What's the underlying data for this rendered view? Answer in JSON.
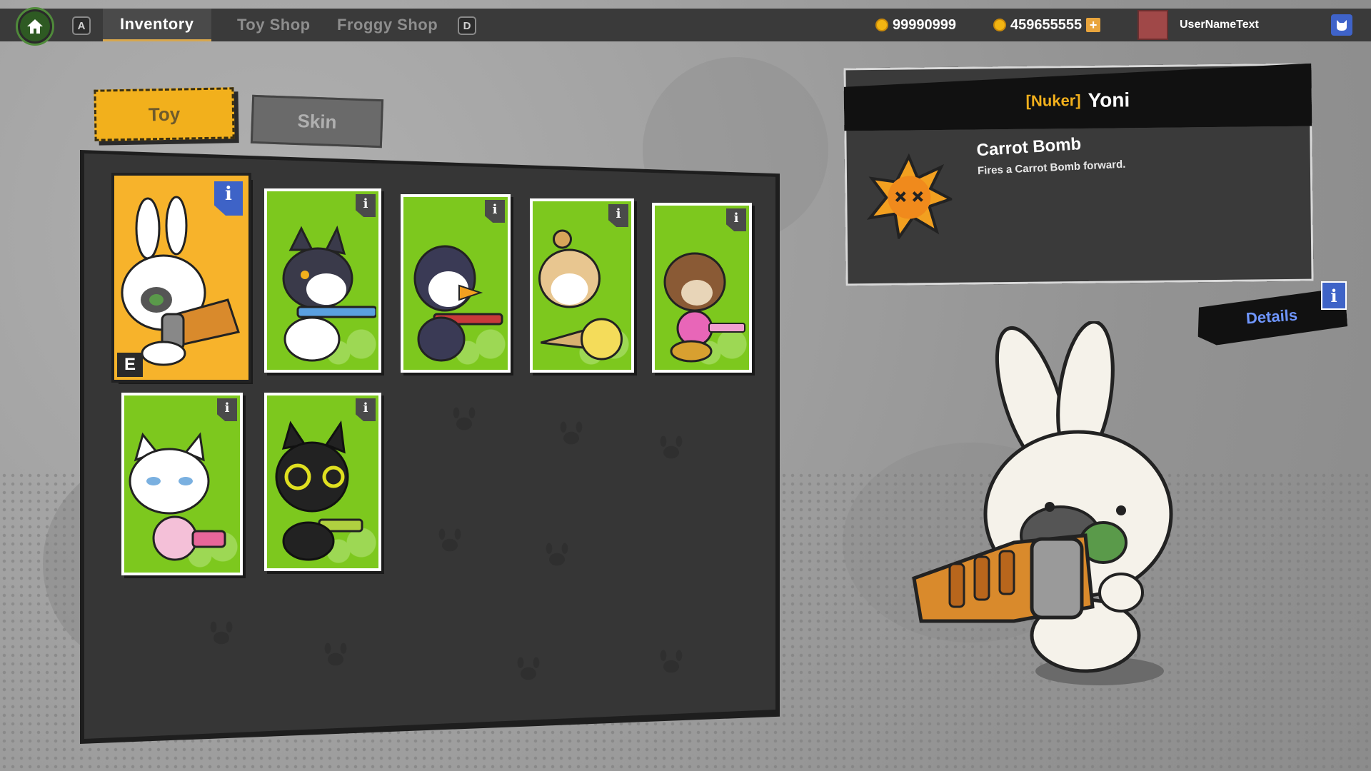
{
  "topbar": {
    "key_left": "A",
    "key_right": "D",
    "tabs": [
      {
        "label": "Inventory",
        "active": true
      },
      {
        "label": "Toy Shop",
        "active": false
      },
      {
        "label": "Froggy Shop",
        "active": false
      }
    ],
    "currency_1": "99990999",
    "currency_2": "459655555",
    "plus": "+",
    "username": "UserNameText"
  },
  "inventory": {
    "tabs": {
      "toy": "Toy",
      "skin": "Skin"
    },
    "equipped_marker": "E",
    "info_glyph": "i",
    "cards": [
      {
        "character": "white rabbit with carrot bazooka",
        "selected": true,
        "equipped": true
      },
      {
        "character": "black cat with rifle",
        "selected": false,
        "equipped": false
      },
      {
        "character": "penguin with water gun",
        "selected": false,
        "equipped": false
      },
      {
        "character": "sheep with ice cream cone launcher",
        "selected": false,
        "equipped": false
      },
      {
        "character": "brown dog with lollipop gun",
        "selected": false,
        "equipped": false
      },
      {
        "character": "white cat with strawberry jar gun",
        "selected": false,
        "equipped": false
      },
      {
        "character": "black cat with green pistol",
        "selected": false,
        "equipped": false
      }
    ]
  },
  "detail": {
    "role": "[Nuker]",
    "name": "Yoni",
    "skill_name": "Carrot Bomb",
    "skill_desc": "Fires a Carrot Bomb forward.",
    "details_label": "Details",
    "info_glyph": "i"
  },
  "colors": {
    "accent_yellow": "#f2b01c",
    "card_green": "#7dc81e",
    "info_blue": "#3e63c7",
    "panel_dark": "#363636"
  },
  "icons": [
    "home-icon",
    "coin-icon",
    "plus-icon",
    "friend-icon",
    "info-icon",
    "explosion-icon",
    "paw-print-icon"
  ]
}
